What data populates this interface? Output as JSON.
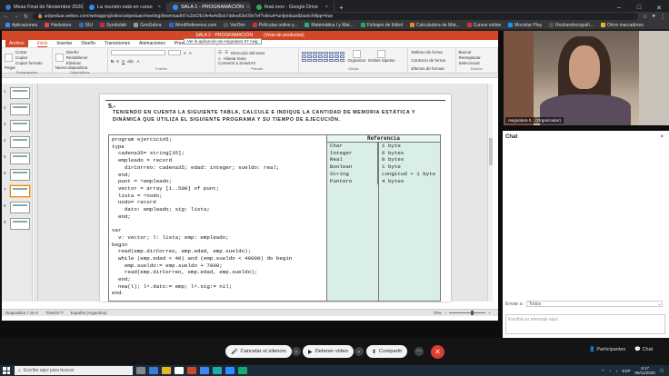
{
  "browser": {
    "tabs": [
      {
        "label": "Mesa Final de Noviembre 2020",
        "color": "#2f7ac0",
        "active": false
      },
      {
        "label": "La reunión está en curso",
        "color": "#2d8cff",
        "active": false
      },
      {
        "label": "SALA 1 - PROGRAMACIÓN",
        "color": "#2d8cff",
        "active": true
      },
      {
        "label": "final.mov - Google Drive",
        "color": "#34a853",
        "active": false
      }
    ],
    "new_tab": "+",
    "url": "unlpeduar.webex.com/webappng/sites/unlpeduar/meeting/download/d7a1b02b1fe4a4d9cb7ddea63e09e7ef?siteurl=unlpeduar&launchApp=true",
    "bookmarks": [
      {
        "label": "Aplicaciones",
        "color": "#4285f4"
      },
      {
        "label": "Hackstore",
        "color": "#e44"
      },
      {
        "label": "SIU",
        "color": "#2c6db0"
      },
      {
        "label": "Symbolab",
        "color": "#d23"
      },
      {
        "label": "GeoGebra",
        "color": "#999"
      },
      {
        "label": "WordReference.com",
        "color": "#36c"
      },
      {
        "label": "VerDim",
        "color": "#555"
      },
      {
        "label": "Películas online y...",
        "color": "#c33"
      },
      {
        "label": "Matemática I y Mat...",
        "color": "#3a7"
      },
      {
        "label": "Fichajes de fútbol",
        "color": "#2a5"
      },
      {
        "label": "Calculadora de Mat...",
        "color": "#e82"
      },
      {
        "label": "Cursos online",
        "color": "#c33"
      },
      {
        "label": "Movistar Play",
        "color": "#19f"
      },
      {
        "label": "Rockandocografi...",
        "color": "#555"
      },
      {
        "label": "Otros marcadores",
        "color": "#e8b620"
      }
    ]
  },
  "ppt": {
    "title": "SALA 2 - PROGRAMACIÓN",
    "share_banner": "Ver la aplicación de Asignatura 07 Asig",
    "view_badge": "(Vista de productos)",
    "menu_tabs": [
      "Archivo",
      "Inicio",
      "Insertar",
      "Diseño",
      "Transiciones",
      "Animaciones",
      "Presentación con diap"
    ],
    "ribbon": {
      "clipboard": {
        "paste": "Pegar",
        "cut": "Cortar",
        "copy": "Copiar",
        "format": "Copiar formato",
        "group": "Portapapeles"
      },
      "slides": {
        "new": "Nueva diapositiva",
        "layout": "Diseño",
        "reset": "Restablecer",
        "delete": "Eliminar",
        "group": "Diapositivas"
      },
      "font": {
        "group": "Fuente"
      },
      "paragraph": {
        "direction": "Dirección del texto",
        "align": "Alinear texto",
        "smartart": "Convertir a SmartArt",
        "group": "Párrafo"
      },
      "drawing": {
        "arrange": "Organizar",
        "styles": "Estilos rápidos",
        "fill": "Relleno de forma",
        "outline": "Contorno de forma",
        "effects": "Efectos de formas",
        "group": "Dibujo"
      },
      "editing": {
        "find": "Buscar",
        "replace": "Reemplazar",
        "select": "Seleccionar",
        "group": "Edición"
      }
    },
    "slide_numbers": [
      "1",
      "2",
      "3",
      "4",
      "5",
      "6",
      "7",
      "8",
      "9"
    ],
    "selected_slide": 7,
    "slide": {
      "qnum": "5.-",
      "question": "TENIENDO EN CUENTA LA SIGUIENTE TABLA, CALCULE E INDIQUE LA CANTIDAD DE MEMORIA ESTÁTICA Y DINÁMICA QUE UTILIZA EL SIGUIENTE PROGRAMA Y SU TIEMPO DE EJECUCIÓN.",
      "code": [
        "program ejercicio5;",
        "type",
        "  cadena35= string[35];",
        "  empleado = record",
        "    dirCorreo: cadena35; edad: integer; sueldo: real;",
        "  end;",
        "  punt = ^empleado;",
        "  vector = array [1..500] of punt;",
        "  lista = ^nodo;",
        "  nodo= record",
        "    dato: empleado; sig: lista;",
        "  end;",
        "",
        "var",
        "  v: vector; l: lista; emp: empleado;",
        "begin",
        "  read(emp.dirCorreo, emp.edad, emp.sueldo);",
        "  while (emp.edad < 40) and (emp.sueldo < 40000) do begin",
        "    emp.sueldo:= emp.sueldo + 7000;",
        "    read(emp.dirCorreo, emp.edad, emp.sueldo);",
        "  end;",
        "  new(l); l^.dato:= emp; l^.sig:= nil;",
        "end."
      ],
      "ref_header": "Referencia",
      "reference": [
        {
          "type": "Char",
          "size": "1 byte"
        },
        {
          "type": "Integer",
          "size": "6 bytes"
        },
        {
          "type": "Real",
          "size": "8 bytes"
        },
        {
          "type": "Boolean",
          "size": "1 byte"
        },
        {
          "type": "String",
          "size": "Longitud + 1 byte"
        },
        {
          "type": "Puntero",
          "size": "4 bytes"
        }
      ]
    },
    "status": {
      "slide": "Diapositiva 7 de 8",
      "theme": "\"Diseño\"T",
      "lang": "Español (Argentina)",
      "zoom": "75%"
    }
  },
  "video": {
    "label": "Asignatura 0... (Organizador)"
  },
  "chat": {
    "title": "Chat",
    "to_label": "Enviar a:",
    "to_value": "Todos",
    "placeholder": "Escriba su mensaje aquí"
  },
  "meeting": {
    "mute": "Cancelar el silencio",
    "stop_video": "Detener vídeo",
    "share": "Compartir",
    "participants": "Participantes",
    "chat": "Chat"
  },
  "taskbar": {
    "search": "Escribe aquí para buscar",
    "lang": "ESP",
    "time": "9:17",
    "date": "05/11/2020"
  }
}
